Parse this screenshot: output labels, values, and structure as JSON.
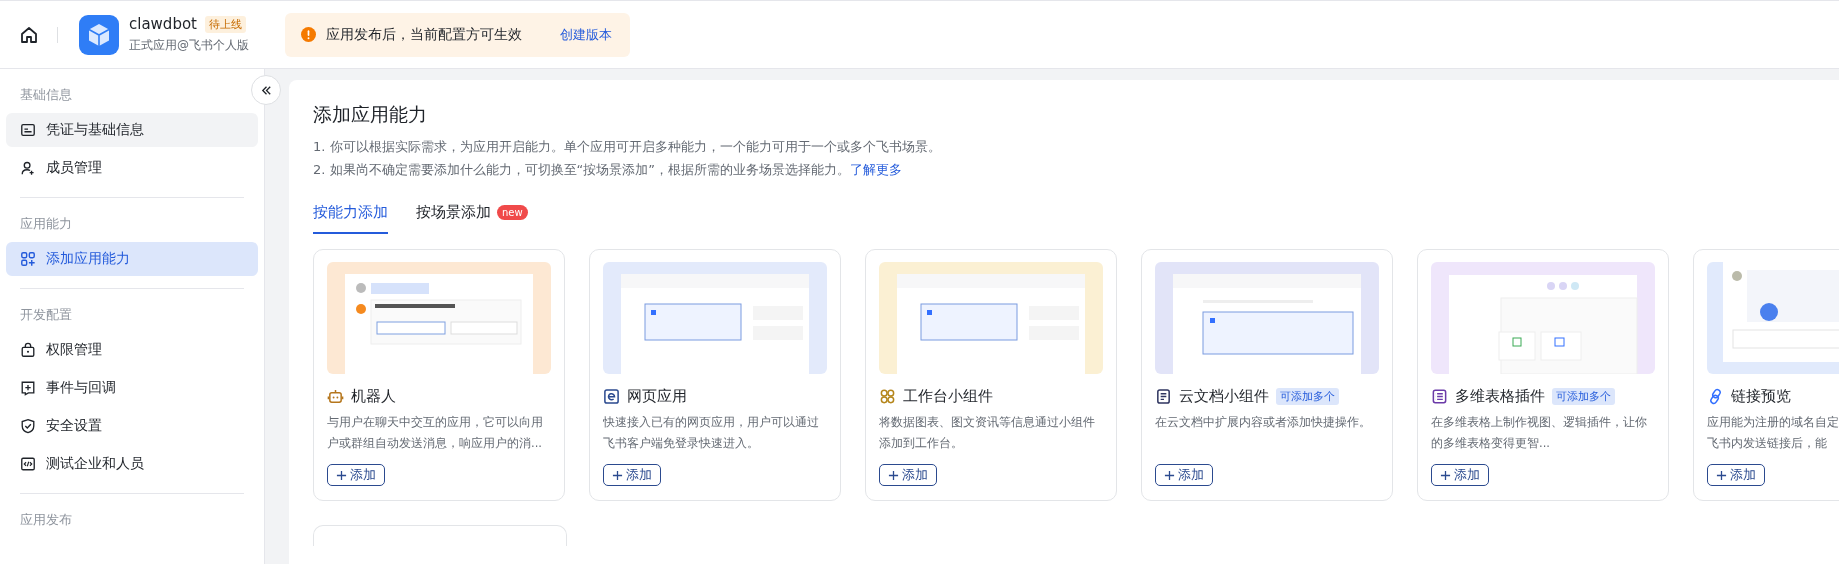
{
  "header": {
    "app_name": "clawdbot",
    "status_badge": "待上线",
    "app_type": "正式应用@飞书个人版",
    "notice": {
      "text": "应用发布后，当前配置方可生效",
      "link": "创建版本"
    }
  },
  "sidebar": {
    "groups": [
      {
        "title": "基础信息",
        "items": [
          {
            "label": "凭证与基础信息",
            "kind": "credential",
            "selected": false,
            "hovered": true
          },
          {
            "label": "成员管理",
            "kind": "member",
            "selected": false,
            "hovered": false
          }
        ]
      },
      {
        "title": "应用能力",
        "items": [
          {
            "label": "添加应用能力",
            "kind": "apps",
            "selected": true,
            "hovered": false
          }
        ]
      },
      {
        "title": "开发配置",
        "items": [
          {
            "label": "权限管理",
            "kind": "lock",
            "selected": false,
            "hovered": false
          },
          {
            "label": "事件与回调",
            "kind": "event",
            "selected": false,
            "hovered": false
          },
          {
            "label": "安全设置",
            "kind": "shield",
            "selected": false,
            "hovered": false
          },
          {
            "label": "测试企业和人员",
            "kind": "code",
            "selected": false,
            "hovered": false
          }
        ]
      },
      {
        "title": "应用发布"
      }
    ]
  },
  "main": {
    "title": "添加应用能力",
    "notes": [
      {
        "text": "1. 你可以根据实际需求，为应用开启能力。单个应用可开启多种能力，一个能力可用于一个或多个飞书场景。"
      },
      {
        "text": "2. 如果尚不确定需要添加什么能力，可切换至“按场景添加”，根据所需的业务场景选择能力。",
        "link": "了解更多"
      }
    ],
    "tabs": [
      {
        "label": "按能力添加",
        "selected": true
      },
      {
        "label": "按场景添加",
        "selected": false,
        "badge": "new"
      }
    ],
    "cards": [
      {
        "title": "机器人",
        "kind": "bot",
        "color": "#fde8d3",
        "description": "与用户在聊天中交互的应用，它可以向用户或群组自动发送消息，响应用户的消...",
        "button": "添加"
      },
      {
        "title": "网页应用",
        "kind": "web",
        "color": "#e3eafb",
        "description": "快速接入已有的网页应用，用户可以通过飞书客户端免登录快速进入。",
        "button": "添加"
      },
      {
        "title": "工作台小组件",
        "kind": "widget",
        "color": "#fbf0d3",
        "description": "将数据图表、图文资讯等信息通过小组件添加到工作台。",
        "button": "添加"
      },
      {
        "title": "云文档小组件",
        "kind": "doc",
        "color": "#e2e4f8",
        "tag": "可添加多个",
        "description": "在云文档中扩展内容或者添加快捷操作。",
        "button": "添加"
      },
      {
        "title": "多维表格插件",
        "kind": "table",
        "color": "#efe6fb",
        "tag": "可添加多个",
        "description": "在多维表格上制作视图、逻辑插件，让你的多维表格变得更智...",
        "button": "添加"
      },
      {
        "title": "链接预览",
        "kind": "link",
        "color": "#e1eafc",
        "description_lines": [
          "应用能为注册的域名自定",
          "飞书内发送链接后，能"
        ],
        "button": "添加"
      }
    ]
  }
}
